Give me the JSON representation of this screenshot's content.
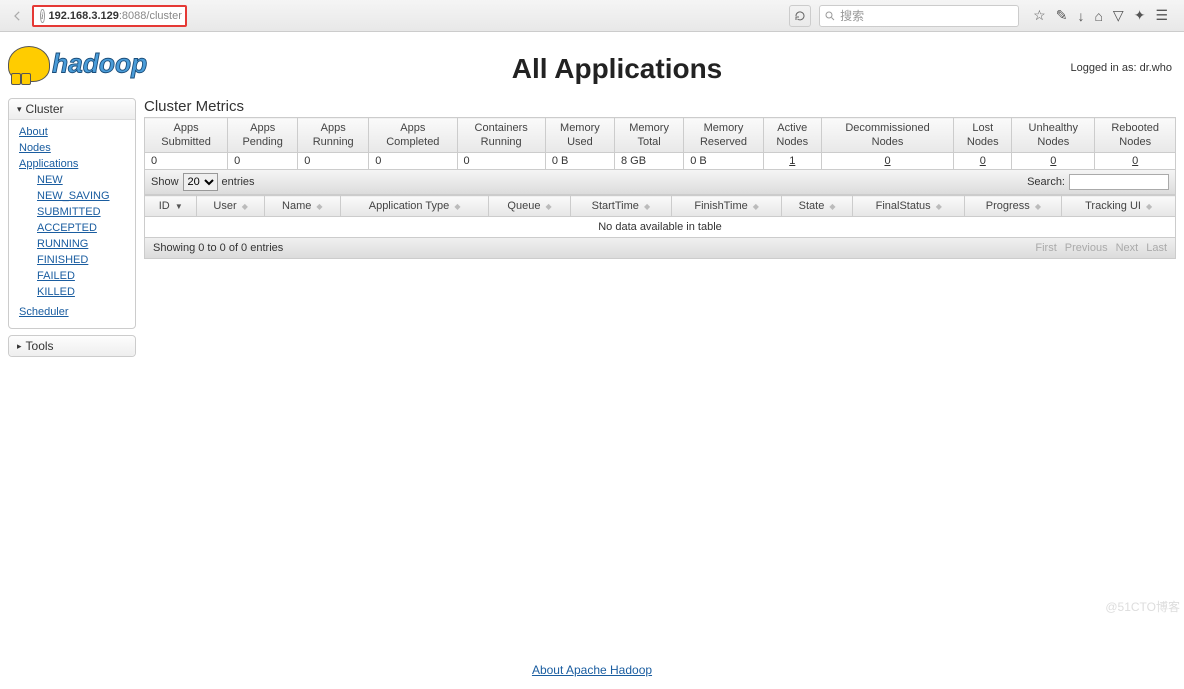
{
  "browser": {
    "url_host": "192.168.3.129",
    "url_port": ":8088",
    "url_path": "/cluster",
    "search_placeholder": "搜索"
  },
  "login_text": "Logged in as: dr.who",
  "page_title": "All Applications",
  "sidebar": {
    "cluster": {
      "title": "Cluster",
      "links": [
        "About",
        "Nodes",
        "Applications"
      ],
      "states": [
        "NEW",
        "NEW_SAVING",
        "SUBMITTED",
        "ACCEPTED",
        "RUNNING",
        "FINISHED",
        "FAILED",
        "KILLED"
      ],
      "scheduler": "Scheduler"
    },
    "tools_title": "Tools"
  },
  "metrics": {
    "title": "Cluster Metrics",
    "headers": [
      "Apps Submitted",
      "Apps Pending",
      "Apps Running",
      "Apps Completed",
      "Containers Running",
      "Memory Used",
      "Memory Total",
      "Memory Reserved",
      "Active Nodes",
      "Decommissioned Nodes",
      "Lost Nodes",
      "Unhealthy Nodes",
      "Rebooted Nodes"
    ],
    "values": [
      "0",
      "0",
      "0",
      "0",
      "0",
      "0 B",
      "8 GB",
      "0 B",
      "1",
      "0",
      "0",
      "0",
      "0"
    ]
  },
  "dt": {
    "show": "Show",
    "entries": "entries",
    "page_length": "20",
    "search_label": "Search:",
    "headers": [
      "ID",
      "User",
      "Name",
      "Application Type",
      "Queue",
      "StartTime",
      "FinishTime",
      "State",
      "FinalStatus",
      "Progress",
      "Tracking UI"
    ],
    "nodata": "No data available in table",
    "info": "Showing 0 to 0 of 0 entries",
    "pager": [
      "First",
      "Previous",
      "Next",
      "Last"
    ]
  },
  "footer_link": "About Apache Hadoop",
  "watermark": "@51CTO博客"
}
